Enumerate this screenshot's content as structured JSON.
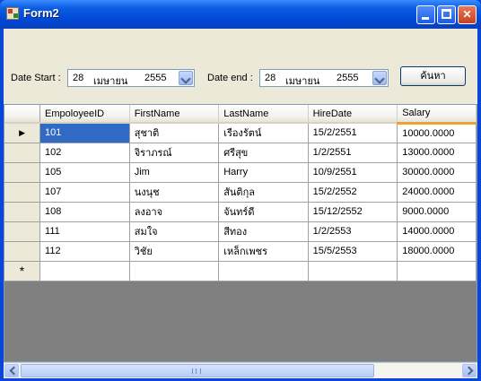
{
  "window": {
    "title": "Form2"
  },
  "filters": {
    "start_label": "Date Start :",
    "start_day": "28",
    "start_month": "เมษายน",
    "start_year": "2555",
    "end_label": "Date end :",
    "end_day": "28",
    "end_month": "เมษายน",
    "end_year": "2555",
    "search_button": "ค้นหา"
  },
  "grid": {
    "columns": [
      "EmpoloyeeID",
      "FirstName",
      "LastName",
      "HireDate",
      "Salary"
    ],
    "rows": [
      [
        "101",
        "สุชาติ",
        "เรืองรัตน์",
        "15/2/2551",
        "10000.0000"
      ],
      [
        "102",
        "จิราภรณ์",
        "ศรีสุข",
        "1/2/2551",
        "13000.0000"
      ],
      [
        "105",
        "Jim",
        "Harry",
        "10/9/2551",
        "30000.0000"
      ],
      [
        "107",
        "นงนุช",
        "สันติกุล",
        "15/2/2552",
        "24000.0000"
      ],
      [
        "108",
        "ลงอาจ",
        "จันทร์ดี",
        "15/12/2552",
        "9000.0000"
      ],
      [
        "111",
        "สมใจ",
        "สีทอง",
        "1/2/2553",
        "14000.0000"
      ],
      [
        "112",
        "วิชัย",
        "เหล็กเพชร",
        "15/5/2553",
        "18000.0000"
      ]
    ],
    "current_row_marker": "▶",
    "new_row_marker": "*"
  }
}
